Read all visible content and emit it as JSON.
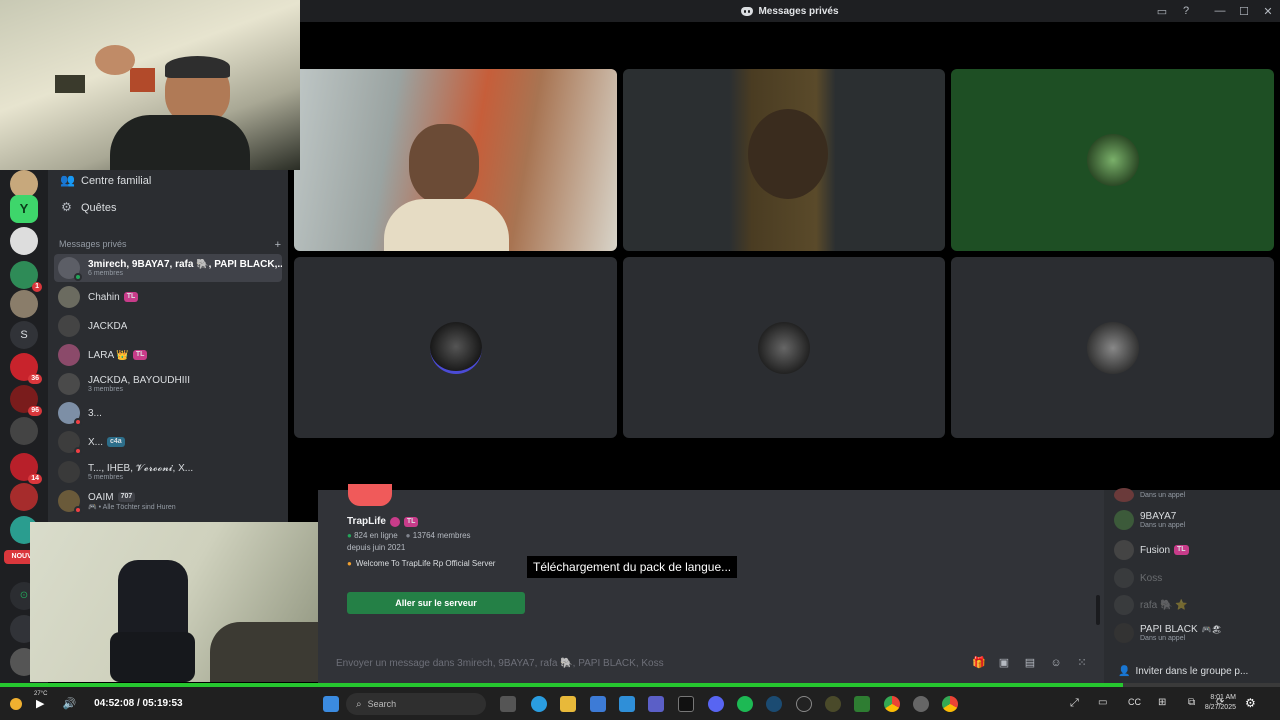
{
  "window": {
    "title": "Messages privés"
  },
  "sidebar": {
    "nav": [
      {
        "label": "Centre familial",
        "icon": "family-icon"
      },
      {
        "label": "Quêtes",
        "icon": "quests-icon"
      }
    ],
    "dm_header": "Messages privés",
    "dm_add": "+",
    "dms": [
      {
        "name": "3mirech, 9BAYA7, rafa 🐘, PAPI BLACK,...",
        "sub": "6 membres",
        "tag": "",
        "status": "#23a55a"
      },
      {
        "name": "Chahin",
        "sub": "",
        "tag": "TL",
        "status": ""
      },
      {
        "name": "JACKDA",
        "sub": "",
        "tag": "",
        "status": ""
      },
      {
        "name": "LARA 👑",
        "sub": "",
        "tag": "TL",
        "status": ""
      },
      {
        "name": "JACKDA, BAYOUDHIII",
        "sub": "3 membres",
        "tag": "",
        "status": ""
      },
      {
        "name": "3...",
        "sub": "",
        "tag": "",
        "status": "#f23f43"
      },
      {
        "name": "X...",
        "sub": "",
        "tag": "c4a",
        "status": "#f23f43"
      },
      {
        "name": "T..., IHEB, 𝓥𝓮𝓻𝓸𝓸𝓷𝓲, X...",
        "sub": "5 membres",
        "tag": "",
        "status": ""
      },
      {
        "name": "OAIM",
        "sub": "🎮 • Alle Töchter sind Huren",
        "tag": "707",
        "status": "#f23f43"
      }
    ],
    "server_badges": [
      "1",
      "36",
      "96",
      "14"
    ],
    "server_letter": "S",
    "new_badge": "NOUVE"
  },
  "invite": {
    "server_name": "TrapLife",
    "tag": "TL",
    "online": "824 en ligne",
    "members": "13764 membres",
    "since": "depuis juin 2021",
    "description": "Welcome To TrapLife Rp Official Server",
    "join_label": "Aller sur le serveur"
  },
  "tooltip": "Téléchargement du pack de langue...",
  "composer": {
    "placeholder": "Envoyer un message dans 3mirech, 9BAYA7, rafa 🐘, PAPI BLACK, Koss"
  },
  "members": [
    {
      "name": "",
      "sub": "Dans un appel",
      "tag": ""
    },
    {
      "name": "9BAYA7",
      "sub": "Dans un appel",
      "tag": ""
    },
    {
      "name": "Fusion",
      "sub": "",
      "tag": "TL"
    },
    {
      "name": "Koss",
      "sub": "",
      "tag": ""
    },
    {
      "name": "rafa 🐘 ⭐",
      "sub": "",
      "tag": ""
    },
    {
      "name": "PAPI BLACK",
      "sub": "Dans un appel",
      "tag": "🎮🏖"
    }
  ],
  "invite_group": "Inviter dans le groupe p...",
  "player": {
    "temp": "27°C",
    "time": "04:52:08 / 05:19:53",
    "progress": 0.877,
    "search": "Search",
    "clock_time": "8:01 AM",
    "clock_date": "8/27/2025"
  },
  "colors": {
    "accent": "#26c72f",
    "join": "#248046",
    "background": "#313338"
  }
}
